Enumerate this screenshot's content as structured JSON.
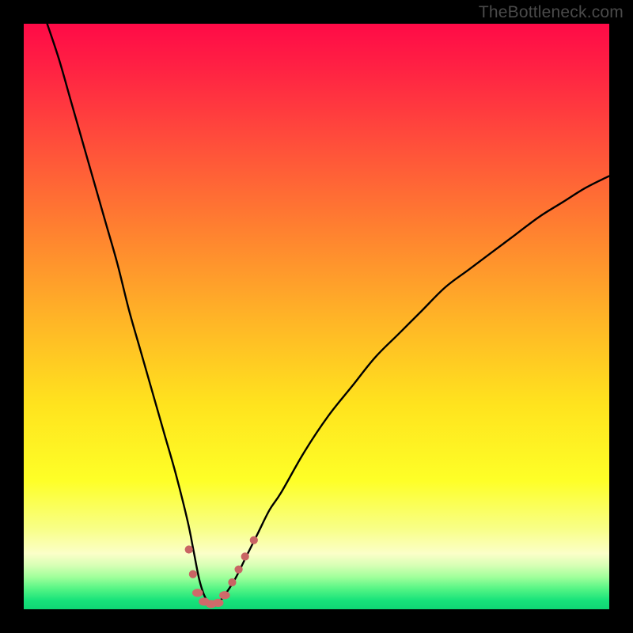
{
  "watermark": "TheBottleneck.com",
  "colors": {
    "background": "#000000",
    "watermark_text": "#4a4a4a",
    "curve_stroke": "#000000",
    "marker_flat": "#cf6a6a",
    "marker_dot": "#c96464",
    "gradient_stops": [
      {
        "offset": 0.0,
        "color": "#ff0a47"
      },
      {
        "offset": 0.08,
        "color": "#ff2343"
      },
      {
        "offset": 0.2,
        "color": "#ff4d3b"
      },
      {
        "offset": 0.35,
        "color": "#ff8030"
      },
      {
        "offset": 0.5,
        "color": "#ffb327"
      },
      {
        "offset": 0.65,
        "color": "#ffe31e"
      },
      {
        "offset": 0.78,
        "color": "#feff27"
      },
      {
        "offset": 0.86,
        "color": "#f8ff84"
      },
      {
        "offset": 0.905,
        "color": "#fbffc8"
      },
      {
        "offset": 0.925,
        "color": "#d7ffb5"
      },
      {
        "offset": 0.945,
        "color": "#a0ff9b"
      },
      {
        "offset": 0.965,
        "color": "#55f585"
      },
      {
        "offset": 0.985,
        "color": "#17e27a"
      },
      {
        "offset": 1.0,
        "color": "#0fd674"
      }
    ]
  },
  "chart_data": {
    "type": "line",
    "title": "",
    "xlabel": "",
    "ylabel": "",
    "xlim": [
      0,
      100
    ],
    "ylim": [
      0,
      100
    ],
    "series": [
      {
        "name": "bottleneck-curve",
        "x": [
          4,
          6,
          8,
          10,
          12,
          14,
          16,
          18,
          20,
          22,
          24,
          26,
          28,
          29,
          30,
          31,
          32,
          33,
          34,
          36,
          38,
          40,
          42,
          44,
          48,
          52,
          56,
          60,
          64,
          68,
          72,
          76,
          80,
          84,
          88,
          92,
          96,
          100
        ],
        "y": [
          100,
          94,
          87,
          80,
          73,
          66,
          59,
          51,
          44,
          37,
          30,
          23,
          15,
          10,
          5,
          2,
          1,
          1,
          2,
          5,
          9,
          13,
          17,
          20,
          27,
          33,
          38,
          43,
          47,
          51,
          55,
          58,
          61,
          64,
          67,
          69.5,
          72,
          74
        ]
      }
    ],
    "markers": {
      "name": "highlight-cluster",
      "points": [
        {
          "x": 28.2,
          "y": 10.2,
          "kind": "dot"
        },
        {
          "x": 28.9,
          "y": 6.0,
          "kind": "dot"
        },
        {
          "x": 29.7,
          "y": 2.8,
          "kind": "flat"
        },
        {
          "x": 30.8,
          "y": 1.3,
          "kind": "flat"
        },
        {
          "x": 32.0,
          "y": 0.9,
          "kind": "flat"
        },
        {
          "x": 33.2,
          "y": 1.1,
          "kind": "flat"
        },
        {
          "x": 34.3,
          "y": 2.4,
          "kind": "flat"
        },
        {
          "x": 35.6,
          "y": 4.6,
          "kind": "dot"
        },
        {
          "x": 36.7,
          "y": 6.8,
          "kind": "dot"
        },
        {
          "x": 37.8,
          "y": 9.0,
          "kind": "dot"
        },
        {
          "x": 39.3,
          "y": 11.8,
          "kind": "dot"
        }
      ]
    }
  }
}
